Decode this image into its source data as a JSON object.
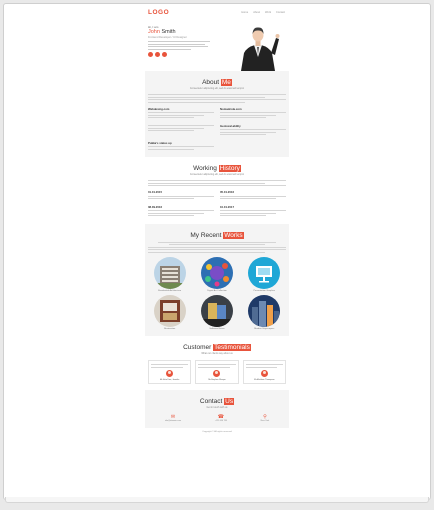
{
  "brand": {
    "logo": "LOGO",
    "accent_color": "#e8543c"
  },
  "nav": {
    "items": [
      "Home",
      "About",
      "Work",
      "Contact"
    ]
  },
  "hero": {
    "greeting": "Hi, I am",
    "first_name": "John",
    "last_name": "Smith",
    "role": "Frontend Developer / UI Designer",
    "social_icons": [
      "facebook-icon",
      "twitter-icon",
      "linkedin-icon"
    ]
  },
  "about": {
    "title_plain": "About",
    "title_highlight": "Me",
    "subtitle": "Consectetur adipiscing elit, sed do eiusmod tempor",
    "blocks": [
      {
        "heading": "Webdesing.com"
      },
      {
        "heading": "Nomadcola.com"
      },
      {
        "heading": ""
      },
      {
        "heading": "Geolocal.ability"
      },
      {
        "heading": "Pukka's status up"
      }
    ]
  },
  "history": {
    "title_plain": "Working",
    "title_highlight": "History",
    "subtitle": "Consectetur adipiscing elit, sed do eiusmod tempor",
    "entries": [
      {
        "date": "01.01.2015"
      },
      {
        "date": "05.01.2016"
      },
      {
        "date": "08.09.2016"
      },
      {
        "date": "10.01.2017"
      }
    ]
  },
  "works": {
    "title_plain": "My Recent",
    "title_highlight": "Works",
    "items": [
      {
        "caption": "Residential Architecture"
      },
      {
        "caption": "Digital Art Collection"
      },
      {
        "caption": "Presentation Graphics"
      },
      {
        "caption": "Restoration"
      },
      {
        "caption": "Software Boxes"
      },
      {
        "caption": "Modern Skyscrapers"
      }
    ]
  },
  "testimonials": {
    "title_plain": "Customer",
    "title_highlight": "Testimonials",
    "subtitle": "What our clients say about us",
    "people": [
      {
        "name": "Mr.John Doe, Jennifer"
      },
      {
        "name": "Mr.Stephen Sharpe"
      },
      {
        "name": "Mr.Matthew Thompson"
      }
    ]
  },
  "contact": {
    "title_plain": "Contact",
    "title_highlight": "Us",
    "subtitle": "Get in touch with us",
    "items": [
      {
        "icon": "mail-icon",
        "value": "info@domain.com"
      },
      {
        "icon": "phone-icon",
        "value": "+123 456 789"
      },
      {
        "icon": "location-icon",
        "value": "New York"
      }
    ]
  },
  "footer": {
    "text": "Copyright © All rights reserved"
  }
}
